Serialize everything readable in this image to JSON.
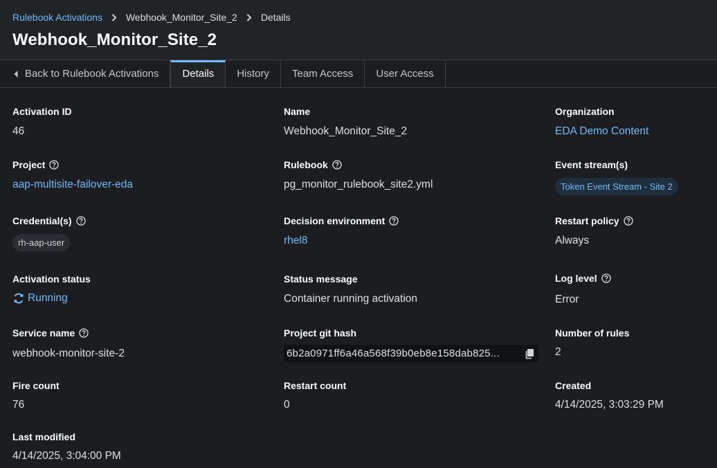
{
  "breadcrumb": {
    "root": "Rulebook Activations",
    "parent": "Webhook_Monitor_Site_2",
    "current": "Details"
  },
  "page_title": "Webhook_Monitor_Site_2",
  "tabs": {
    "back": "Back to Rulebook Activations",
    "details": "Details",
    "history": "History",
    "team_access": "Team Access",
    "user_access": "User Access"
  },
  "fields": {
    "activation_id": {
      "label": "Activation ID",
      "value": "46"
    },
    "name": {
      "label": "Name",
      "value": "Webhook_Monitor_Site_2"
    },
    "organization": {
      "label": "Organization",
      "value": "EDA Demo Content"
    },
    "project": {
      "label": "Project",
      "value": "aap-multisite-failover-eda"
    },
    "rulebook": {
      "label": "Rulebook",
      "value": "pg_monitor_rulebook_site2.yml"
    },
    "event_streams": {
      "label": "Event stream(s)",
      "value": "Token Event Stream - Site 2"
    },
    "credentials": {
      "label": "Credential(s)",
      "value": "rh-aap-user"
    },
    "decision_environment": {
      "label": "Decision environment",
      "value": "rhel8"
    },
    "restart_policy": {
      "label": "Restart policy",
      "value": "Always"
    },
    "activation_status": {
      "label": "Activation status",
      "value": "Running"
    },
    "status_message": {
      "label": "Status message",
      "value": "Container running activation"
    },
    "log_level": {
      "label": "Log level",
      "value": "Error"
    },
    "service_name": {
      "label": "Service name",
      "value": "webhook-monitor-site-2"
    },
    "project_git_hash": {
      "label": "Project git hash",
      "value": "6b2a0971ff6a46a568f39b0eb8e158dab825..."
    },
    "number_of_rules": {
      "label": "Number of rules",
      "value": "2"
    },
    "fire_count": {
      "label": "Fire count",
      "value": "76"
    },
    "restart_count": {
      "label": "Restart count",
      "value": "0"
    },
    "created": {
      "label": "Created",
      "value": "4/14/2025, 3:03:29 PM"
    },
    "last_modified": {
      "label": "Last modified",
      "value": "4/14/2025, 3:04:00 PM"
    }
  },
  "colors": {
    "link": "#73bcf7",
    "background": "#1b1d21",
    "header": "#212427"
  },
  "icons": {
    "help": "question-circle-icon",
    "status": "sync-icon",
    "copy": "copy-icon",
    "back": "caret-left-icon",
    "breadcrumb_sep": "chevron-right-icon"
  }
}
